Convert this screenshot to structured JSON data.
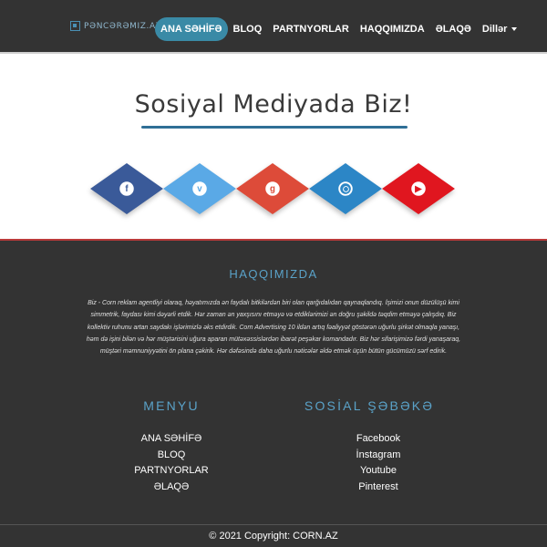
{
  "brand": {
    "logo_text": "PƏNCƏRƏMIZ.AZ"
  },
  "nav": {
    "items": [
      {
        "label": "ANA SƏHİFƏ"
      },
      {
        "label": "BLOQ"
      },
      {
        "label": "PARTNYORLAR"
      },
      {
        "label": "HAQQIMIZDA"
      },
      {
        "label": "ƏLAQƏ"
      },
      {
        "label": "Dillər"
      }
    ]
  },
  "hero": {
    "title": "Sosiyal Mediyada Biz!",
    "socials": [
      {
        "name": "facebook-icon",
        "glyph": "f",
        "color": "#3a5a99"
      },
      {
        "name": "vimeo-icon",
        "glyph": "v",
        "color": "#5aa9e6"
      },
      {
        "name": "google-plus-icon",
        "glyph": "g",
        "color": "#dd4b39"
      },
      {
        "name": "instagram-icon",
        "glyph": "",
        "color": "#2c86c6"
      },
      {
        "name": "youtube-icon",
        "glyph": "▶",
        "color": "#e0161f"
      }
    ]
  },
  "footer": {
    "about_title": "HAQQIMIZDA",
    "about_text": "Biz - Corn reklam agentliyi olaraq, həyatımızda ən faydalı bitkilərdən biri olan qarğıdalıdan qaynaqlandıq. İşimizi onun düzülüşü kimi simmetrik, faydası kimi dəyərli etdik. Hər zaman ən yaxşısını etməyə və etdiklərimizi ən doğru şəkildə təqdim etməyə çalışdıq. Biz kollektiv ruhunu artan saydakı işlərimizlə əks etdirdik. Corn Advertising 10 ildən artıq fəaliyyət göstərən uğurlu şirkət olmaqla yanaşı, həm də işini bilən və hər müştərisini uğura aparan mütəxəssislərdən ibarət peşəkar komandadır. Biz hər sifarişimizə fərdi yanaşaraq, müştəri məmnuniyyətini ön plana çəkirik. Hər dəfəsində daha uğurlu nəticələr əldə etmək üçün bütün gücümüzü sərf edirik.",
    "menu_title": "MENYU",
    "menu_items": [
      "ANA SƏHİFƏ",
      "BLOQ",
      "PARTNYORLAR",
      "ƏLAQƏ"
    ],
    "social_title": "SOSİAL ŞƏBƏKƏ",
    "social_items": [
      "Facebook",
      "İnstagram",
      "Youtube",
      "Pinterest"
    ],
    "copyright": "© 2021 Copyright: CORN.AZ"
  },
  "colors": {
    "accent": "#5aa2c8",
    "active_nav": "#3a8aa6",
    "background": "#333333"
  }
}
